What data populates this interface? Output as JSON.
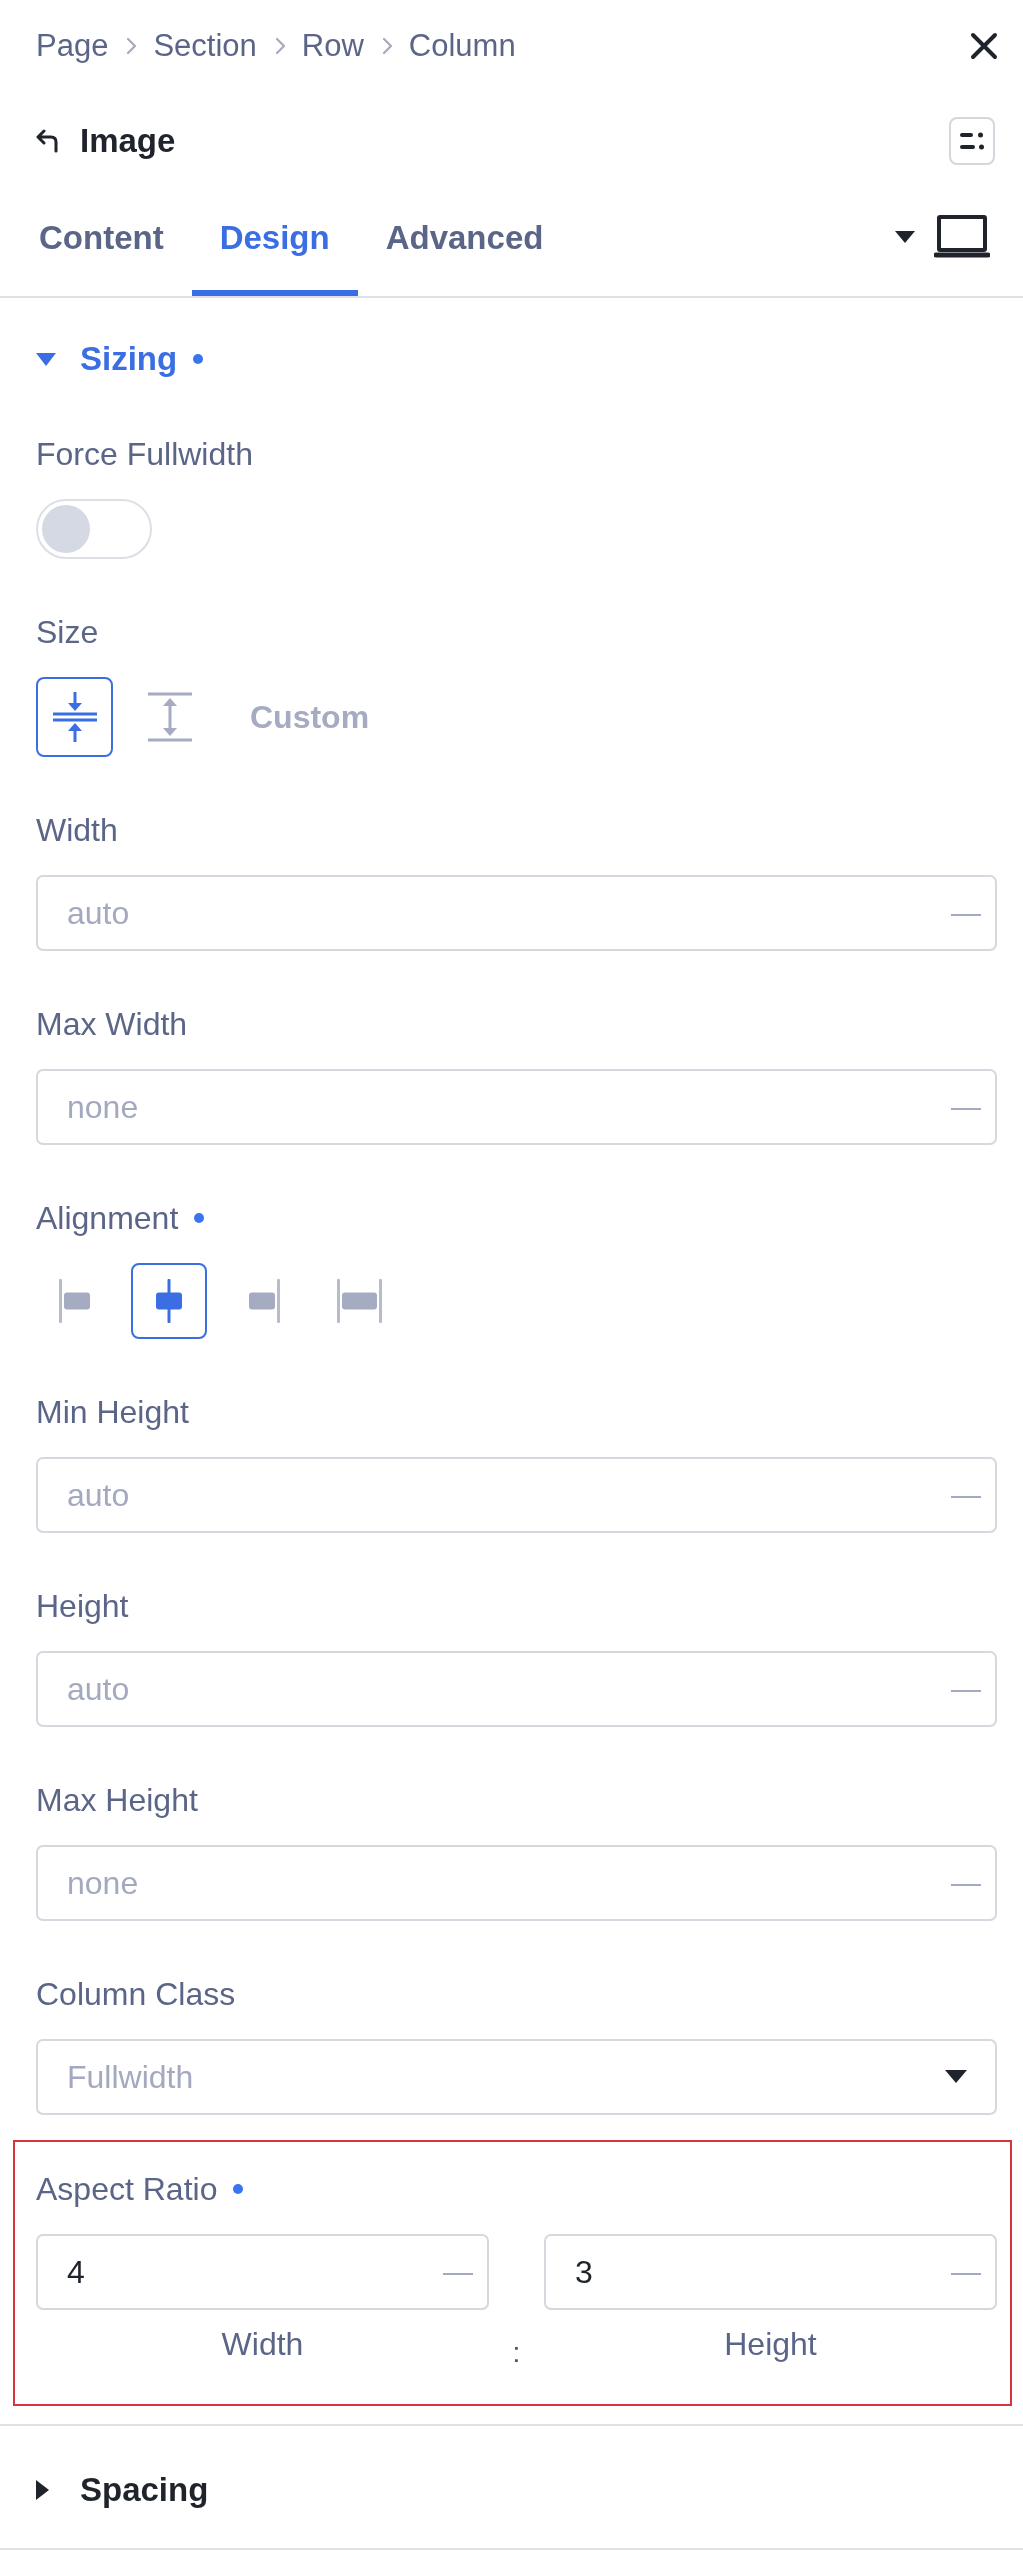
{
  "breadcrumb": [
    "Page",
    "Section",
    "Row",
    "Column"
  ],
  "panel": {
    "title": "Image"
  },
  "tabs": [
    {
      "label": "Content",
      "selected": false
    },
    {
      "label": "Design",
      "selected": true
    },
    {
      "label": "Advanced",
      "selected": false
    }
  ],
  "sections": [
    {
      "title": "Sizing",
      "expanded": true,
      "modified": true,
      "fields": [
        {
          "kind": "toggle",
          "label": "Force Fullwidth",
          "modified": false,
          "highlighted": false,
          "on": false
        },
        {
          "kind": "size",
          "label": "Size",
          "modified": false,
          "highlighted": false,
          "options": [
            {
              "selected": true
            },
            {
              "selected": false
            },
            {
              "label": "Custom",
              "selected": false
            }
          ]
        },
        {
          "kind": "input",
          "label": "Width",
          "modified": false,
          "highlighted": false,
          "placeholder": "auto",
          "unit": "—"
        },
        {
          "kind": "input",
          "label": "Max Width",
          "modified": false,
          "highlighted": false,
          "placeholder": "none",
          "unit": "—"
        },
        {
          "kind": "align",
          "label": "Alignment",
          "modified": true,
          "highlighted": false,
          "options": [
            {
              "selected": false
            },
            {
              "selected": true
            },
            {
              "selected": false
            },
            {
              "selected": false
            }
          ]
        },
        {
          "kind": "input",
          "label": "Min Height",
          "modified": false,
          "highlighted": false,
          "placeholder": "auto",
          "unit": "—"
        },
        {
          "kind": "input",
          "label": "Height",
          "modified": false,
          "highlighted": false,
          "placeholder": "auto",
          "unit": "—"
        },
        {
          "kind": "input",
          "label": "Max Height",
          "modified": false,
          "highlighted": false,
          "placeholder": "none",
          "unit": "—"
        },
        {
          "kind": "select",
          "label": "Column Class",
          "modified": false,
          "highlighted": false,
          "placeholder": "Fullwidth"
        },
        {
          "kind": "ratio",
          "label": "Aspect Ratio",
          "modified": true,
          "highlighted": true,
          "separator": ":",
          "inputs": [
            {
              "value": "4",
              "unit": "—",
              "caption": "Width"
            },
            {
              "value": "3",
              "unit": "—",
              "caption": "Height"
            }
          ]
        }
      ]
    },
    {
      "title": "Spacing",
      "expanded": false,
      "modified": false
    }
  ]
}
